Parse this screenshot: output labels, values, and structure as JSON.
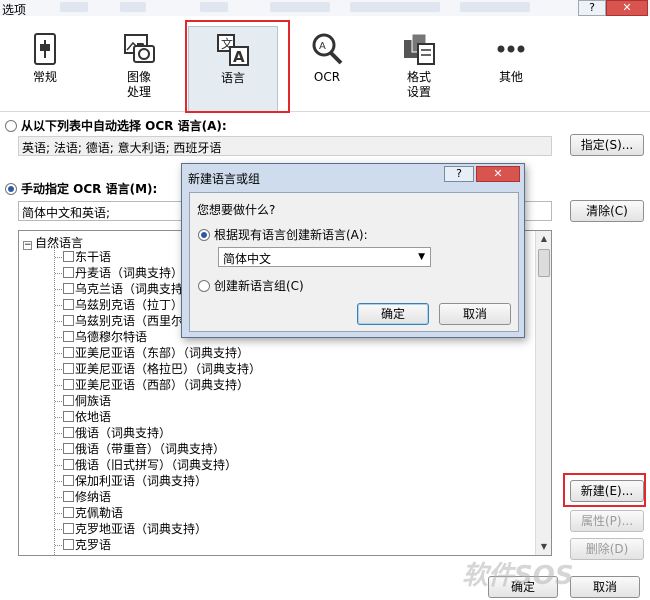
{
  "window": {
    "title": "选项",
    "help_label": "?",
    "close_label": "✕"
  },
  "toolbar": {
    "items": [
      {
        "label_line1": "常规",
        "label_line2": "",
        "icon": "general-icon"
      },
      {
        "label_line1": "图像",
        "label_line2": "处理",
        "icon": "image-camera-icon"
      },
      {
        "label_line1": "语言",
        "label_line2": "",
        "icon": "language-icon"
      },
      {
        "label_line1": "OCR",
        "label_line2": "",
        "icon": "magnifier-icon"
      },
      {
        "label_line1": "格式",
        "label_line2": "设置",
        "icon": "format-icon"
      },
      {
        "label_line1": "其他",
        "label_line2": "",
        "icon": "more-dots-icon"
      }
    ],
    "selected_index": 2
  },
  "auto_section": {
    "label": "从以下列表中自动选择 OCR 语言(A):",
    "value": "英语; 法语; 德语; 意大利语; 西班牙语",
    "button": "指定(S)..."
  },
  "manual_section": {
    "label": "手动指定 OCR 语言(M):",
    "value": "简体中文和英语;",
    "button": "清除(C)"
  },
  "tree": {
    "root_label": "自然语言",
    "items": [
      "东干语",
      "丹麦语（词典支持）",
      "乌克兰语（词典支持）",
      "乌兹别克语（拉丁）",
      "乌兹别克语（西里尔）",
      "乌德穆尔特语",
      "亚美尼亚语（东部）（词典支持）",
      "亚美尼亚语（格拉巴）（词典支持）",
      "亚美尼亚语（西部）（词典支持）",
      "侗族语",
      "依地语",
      "俄语（词典支持）",
      "俄语（带重音）（词典支持）",
      "俄语（旧式拼写）（词典支持）",
      "保加利亚语（词典支持）",
      "修纳语",
      "克佩勒语",
      "克罗地亚语（词典支持）",
      "克罗语"
    ]
  },
  "side_buttons": {
    "new": "新建(E)...",
    "properties": "属性(P)...",
    "delete": "删除(D)"
  },
  "footer": {
    "ok": "确定",
    "cancel": "取消"
  },
  "dialog": {
    "title": "新建语言或组",
    "help_label": "?",
    "close_label": "✕",
    "question": "您想要做什么?",
    "option1": "根据现有语言创建新语言(A):",
    "select_value": "简体中文",
    "option2": "创建新语言组(C)",
    "ok": "确定",
    "cancel": "取消"
  },
  "watermark": "软件SOS",
  "colors": {
    "highlight": "#e0282f",
    "selected_tab_bg": "#e4ebf1",
    "dialog_frame": "#cfdced"
  }
}
